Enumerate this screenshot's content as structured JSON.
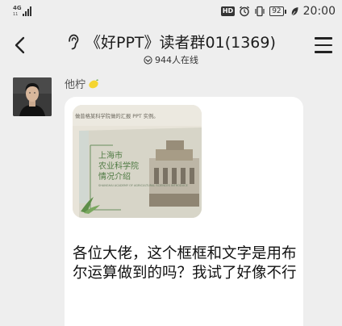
{
  "status_bar": {
    "network": "4G",
    "network_sub": "11",
    "hd": "HD",
    "battery": "92",
    "time": "20:00"
  },
  "nav": {
    "title": "《好PPT》读者群01(1369)",
    "online": "944人在线"
  },
  "message": {
    "sender": "他柠",
    "image": {
      "header_text": "做普格某科学院做的汇报 PPT 实例。",
      "card_line1": "上海市",
      "card_line2": "农业科学院",
      "card_line3": "情况介绍",
      "card_subtitle": "SHANGHAI ACADEMY OF AGRICULTURAL SCIENCES INTRODUCE"
    },
    "text": "各位大佬，这个框框和文字是用布尔运算做到的吗？我试了好像不行"
  },
  "colors": {
    "background": "#eeeeee",
    "bubble": "#ffffff",
    "card_text": "#4f7a43"
  }
}
